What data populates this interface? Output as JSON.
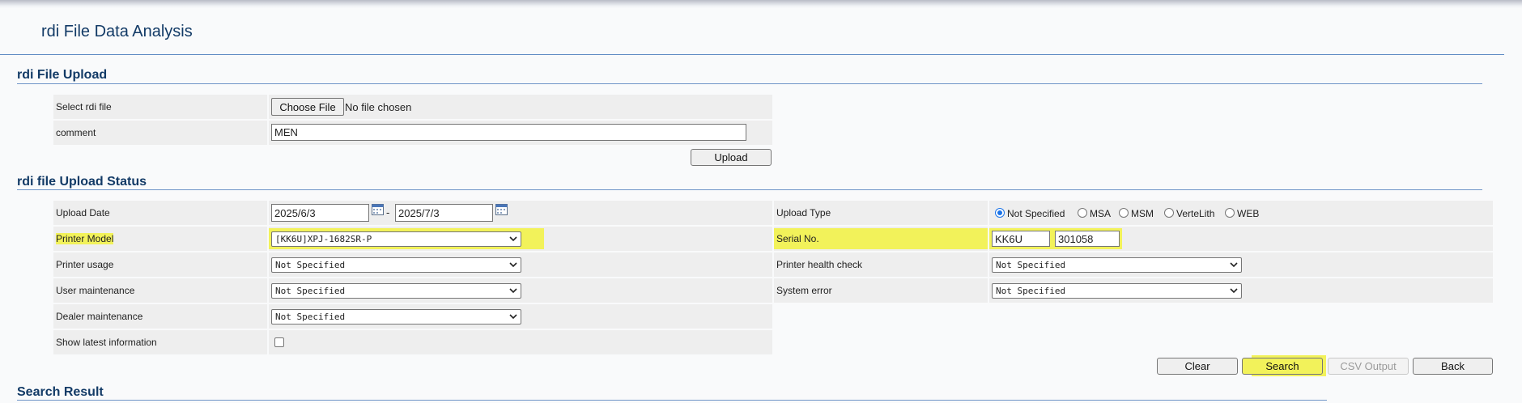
{
  "page": {
    "title": "rdi File Data Analysis"
  },
  "upload_section": {
    "title": "rdi File Upload",
    "select_file_label": "Select rdi file",
    "choose_file_button": "Choose File",
    "no_file_text": "No file chosen",
    "comment_label": "comment",
    "comment_value": "MEN",
    "upload_button": "Upload"
  },
  "status_section": {
    "title": "rdi file Upload Status",
    "upload_date_label": "Upload Date",
    "date_from": "2025/6/3",
    "date_separator": "-",
    "date_to": "2025/7/3",
    "upload_type_label": "Upload Type",
    "upload_type_options": [
      "Not Specified",
      "MSA",
      "MSM",
      "VerteLith",
      "WEB"
    ],
    "upload_type_selected": "Not Specified",
    "printer_model_label": "Printer Model",
    "printer_model_value": "[KK6U]XPJ-1682SR-P",
    "serial_no_label": "Serial No.",
    "serial_prefix": "KK6U",
    "serial_number": "301058",
    "printer_usage_label": "Printer usage",
    "printer_usage_value": "Not Specified",
    "printer_health_label": "Printer health check",
    "printer_health_value": "Not Specified",
    "user_maint_label": "User maintenance",
    "user_maint_value": "Not Specified",
    "system_error_label": "System error",
    "system_error_value": "Not Specified",
    "dealer_maint_label": "Dealer maintenance",
    "dealer_maint_value": "Not Specified",
    "show_latest_label": "Show latest information",
    "show_latest_checked": false
  },
  "actions": {
    "clear": "Clear",
    "search": "Search",
    "csv": "CSV Output",
    "back": "Back"
  },
  "result_section": {
    "title": "Search Result"
  },
  "colors": {
    "highlight": "#f2f25a",
    "heading": "#123a66",
    "rule": "#6f95c8"
  }
}
